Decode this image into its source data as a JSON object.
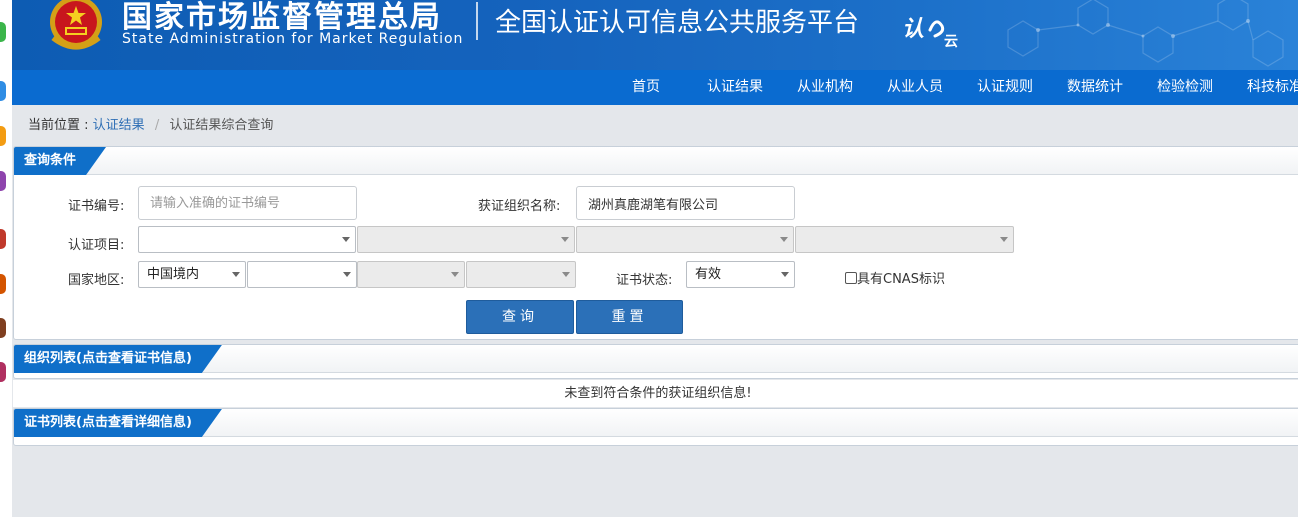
{
  "header": {
    "agency_cn": "国家市场监督管理总局",
    "agency_en": "State Administration  for  Market Regulation",
    "platform_title": "全国认证认可信息公共服务平台",
    "logo_text": "认e云",
    "emblem_icon": "national-emblem",
    "brand_color": "#0d5cb3"
  },
  "nav": {
    "items": [
      "首页",
      "认证结果",
      "从业机构",
      "从业人员",
      "认证规则",
      "数据统计",
      "检验检测",
      "科技标准"
    ],
    "color": "#0a6bd0"
  },
  "breadcrumb": {
    "prefix": "当前位置 :",
    "link": "认证结果",
    "separator": "/",
    "current": "认证结果综合查询"
  },
  "query_panel": {
    "title": "查询条件",
    "cert_no_label": "证书编号:",
    "cert_no_placeholder": "请输入准确的证书编号",
    "org_name_label": "获证组织名称:",
    "org_name_value": "湖州真鹿湖笔有限公司",
    "project_label": "认证项目:",
    "region_label": "国家地区:",
    "region_value": "中国境内",
    "status_label": "证书状态:",
    "status_value": "有效",
    "cnas_label": "具有CNAS标识",
    "cnas_checked": false,
    "query_button": "查询",
    "reset_button": "重置"
  },
  "org_panel": {
    "title": "组织列表(点击查看证书信息)",
    "empty_message": "未查到符合条件的获证组织信息!"
  },
  "cert_panel": {
    "title": "证书列表(点击查看详细信息)"
  },
  "desktop_icons": [
    {
      "name": "app-icon",
      "color": "#3bb54a"
    },
    {
      "name": "app-icon",
      "color": "#2f8de4"
    },
    {
      "name": "app-icon",
      "color": "#f39c12"
    },
    {
      "name": "app-icon",
      "color": "#8e44ad"
    },
    {
      "name": "game-icon",
      "color": "#c0392b"
    },
    {
      "name": "game-icon",
      "color": "#d35400"
    },
    {
      "name": "game-icon",
      "color": "#7f3f20"
    },
    {
      "name": "game-icon",
      "color": "#b03060"
    }
  ]
}
